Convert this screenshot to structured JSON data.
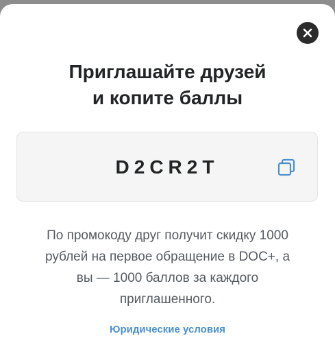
{
  "modal": {
    "title_line1": "Приглашайте друзей",
    "title_line2": "и копите баллы",
    "promo_code": "D2CR2T",
    "description_lines": [
      "По промокоду друг получит скидку 1000",
      "рублей на первое обращение в DOC+, а",
      "вы — 1000 баллов за каждого",
      "приглашенного."
    ],
    "legal_link": "Юридические условия"
  },
  "icons": {
    "close": "close-icon",
    "copy": "copy-icon"
  },
  "colors": {
    "accent": "#4a8fd1",
    "title": "#222426",
    "text": "#555a60",
    "close_bg": "#2b2b2b"
  }
}
